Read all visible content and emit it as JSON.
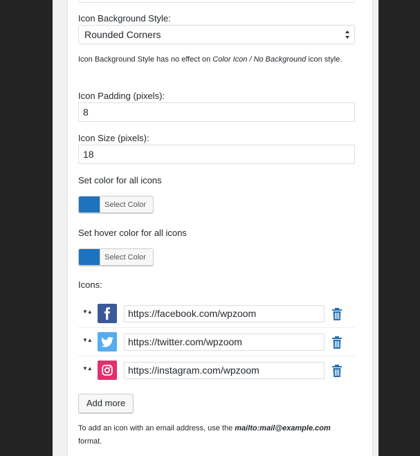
{
  "icon_background_style": {
    "label": "Icon Background Style:",
    "selected": "Rounded Corners",
    "note_prefix": "Icon Background Style has no effect on ",
    "note_emphasis": "Color Icon / No Background",
    "note_suffix": " icon style."
  },
  "icon_padding": {
    "label": "Icon Padding (pixels):",
    "value": "8"
  },
  "icon_size": {
    "label": "Icon Size (pixels):",
    "value": "18"
  },
  "icon_color": {
    "label": "Set color for all icons",
    "button": "Select Color",
    "swatch": "#1e73be"
  },
  "hover_color": {
    "label": "Set hover color for all icons",
    "button": "Select Color",
    "swatch": "#1e73be"
  },
  "icons": {
    "label": "Icons:",
    "items": [
      {
        "network": "facebook-icon",
        "url": "https://facebook.com/wpzoom",
        "bg": "#3b5998"
      },
      {
        "network": "twitter-icon",
        "url": "https://twitter.com/wpzoom",
        "bg": "#55acee"
      },
      {
        "network": "instagram-icon",
        "url": "https://instagram.com/wpzoom",
        "bg": "#e1306c"
      }
    ],
    "add_more": "Add more"
  },
  "footer_note": {
    "prefix": "To add an icon with an email address, use the ",
    "emphasis": "mailto:mail@example.com",
    "suffix": " format."
  }
}
